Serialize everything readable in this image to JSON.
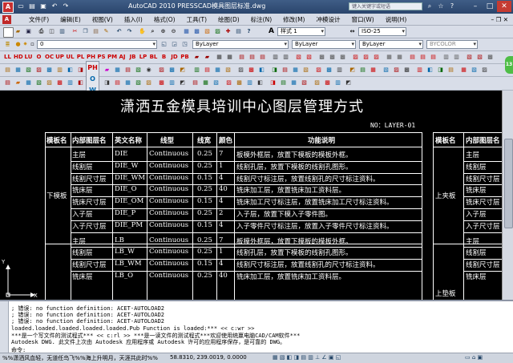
{
  "window": {
    "title": "AutoCAD 2010   PRESSCAD模具图层标准.dwg",
    "search_placeholder": "键入关键字或短语"
  },
  "menu": [
    "文件(F)",
    "编辑(E)",
    "视图(V)",
    "插入(I)",
    "格式(O)",
    "工具(T)",
    "绘图(D)",
    "标注(N)",
    "修改(M)",
    "冲模设计",
    "窗口(W)",
    "说明(H)"
  ],
  "toolbar": {
    "textstyle": "样式 1",
    "dimstyle": "ISO-25",
    "layer": "0",
    "color": "ByLayer",
    "linetype": "ByLayer",
    "lineweight": "ByLayer",
    "plotstyle": "BYCOLOR",
    "vertical_labels": [
      "PH",
      "O",
      "W",
      "P",
      "A",
      "PE",
      "集",
      "CH",
      "CO"
    ]
  },
  "drawing": {
    "title": "潇洒五金模具培训中心图层管理方式",
    "number": "NO：LAYER-01",
    "headers": [
      "模板名",
      "内部图层名",
      "英文名称",
      "线型",
      "线宽",
      "颜色",
      "功能说明"
    ],
    "right_headers": [
      "模板名",
      "内部图层名"
    ],
    "left_group": "下模板",
    "right_group": "上夹板",
    "right_group2": "上垫板",
    "rows": [
      {
        "name": "主层",
        "en": "DIE",
        "lt": "Continuous",
        "lw": "0.25",
        "color": "7",
        "desc": "板模外框层，放置下模板的模板外框。"
      },
      {
        "name": "线割层",
        "en": "DIE_W",
        "lt": "Continuous",
        "lw": "0.25",
        "color": "1",
        "desc": "线割孔层，放置下模板的线割孔图形。"
      },
      {
        "name": "线割尺寸层",
        "en": "DIE_WM",
        "lt": "Continuous",
        "lw": "0.15",
        "color": "4",
        "desc": "线割尺寸标注层，放置线割孔的尺寸标注资料。"
      },
      {
        "name": "铣床层",
        "en": "DIE_O",
        "lt": "Continuous",
        "lw": "0.25",
        "color": "40",
        "desc": "铣床加工层，放置铣床加工资料层。"
      },
      {
        "name": "铣床尺寸层",
        "en": "DIE_OM",
        "lt": "Continuous",
        "lw": "0.15",
        "color": "4",
        "desc": "铣床加工尺寸标注层，放置铣床加工尺寸标注资料。"
      },
      {
        "name": "入子层",
        "en": "DIE_P",
        "lt": "Continuous",
        "lw": "0.25",
        "color": "2",
        "desc": "入子层，放置下模入子零件图。"
      },
      {
        "name": "入子尺寸层",
        "en": "DIE_PM",
        "lt": "Continuous",
        "lw": "0.15",
        "color": "4",
        "desc": "入子零件尺寸标注层，放置入子零件尺寸标注资料。"
      },
      {
        "name": "主层",
        "en": "LB",
        "lt": "Continuous",
        "lw": "0.25",
        "color": "7",
        "desc": "板模外框层，放置下模板的模板外框。"
      },
      {
        "name": "线割层",
        "en": "LB_W",
        "lt": "Continuous",
        "lw": "0.25",
        "color": "1",
        "desc": "线割孔层，放置下模板的线割孔图形。"
      },
      {
        "name": "线割尺寸层",
        "en": "LB_WM",
        "lt": "Continuous",
        "lw": "0.15",
        "color": "4",
        "desc": "线割尺寸标注层，放置线割孔的尺寸标注资料。"
      },
      {
        "name": "铣床层",
        "en": "LB_O",
        "lt": "Continuous",
        "lw": "0.25",
        "color": "40",
        "desc": "铣床加工层，放置铣床加工资料层。"
      }
    ],
    "right_col": [
      "主层",
      "线割层",
      "线割尺寸层",
      "铣床层",
      "铣床尺寸层",
      "入子层",
      "入子尺寸层",
      "主层",
      "线割层",
      "线割尺寸层",
      "铣床层"
    ],
    "axis_x": "X",
    "axis_y": "Y"
  },
  "command": {
    "lines": [
      "; 错误: no function definition: ACET-AUTOLOAD2",
      "; 错误: no function definition: ACET-AUTOLOAD2",
      "; 错误: no function definition: ACET-AUTOLOAD2",
      "loaded.loaded.loaded.loaded.loaded.Pub Function is loaded:*** << c:wr >>",
      "***是一个写文件的测试程式***  << c:rl >>  ***是一读文件的测试程式***欢迎使用统赢电脑CAD/CAM软件***",
      "Autodesk DWG.   此文件上次由 Autodesk 应用程序或 Autodesk 许可的应用程序保存，是可靠的 DWG。",
      "命令:"
    ]
  },
  "status": {
    "left": "%%潇洒风血轻，无道任鸟飞%%海上升明月，天涯共此时%%",
    "coords": "58.8310,  239.0019,  0.0000"
  },
  "colors": {
    "titlebar": "#2f4b74",
    "toolbar": "#d8dde8",
    "canvas": "#000000",
    "rtool": "#4ebd46"
  }
}
